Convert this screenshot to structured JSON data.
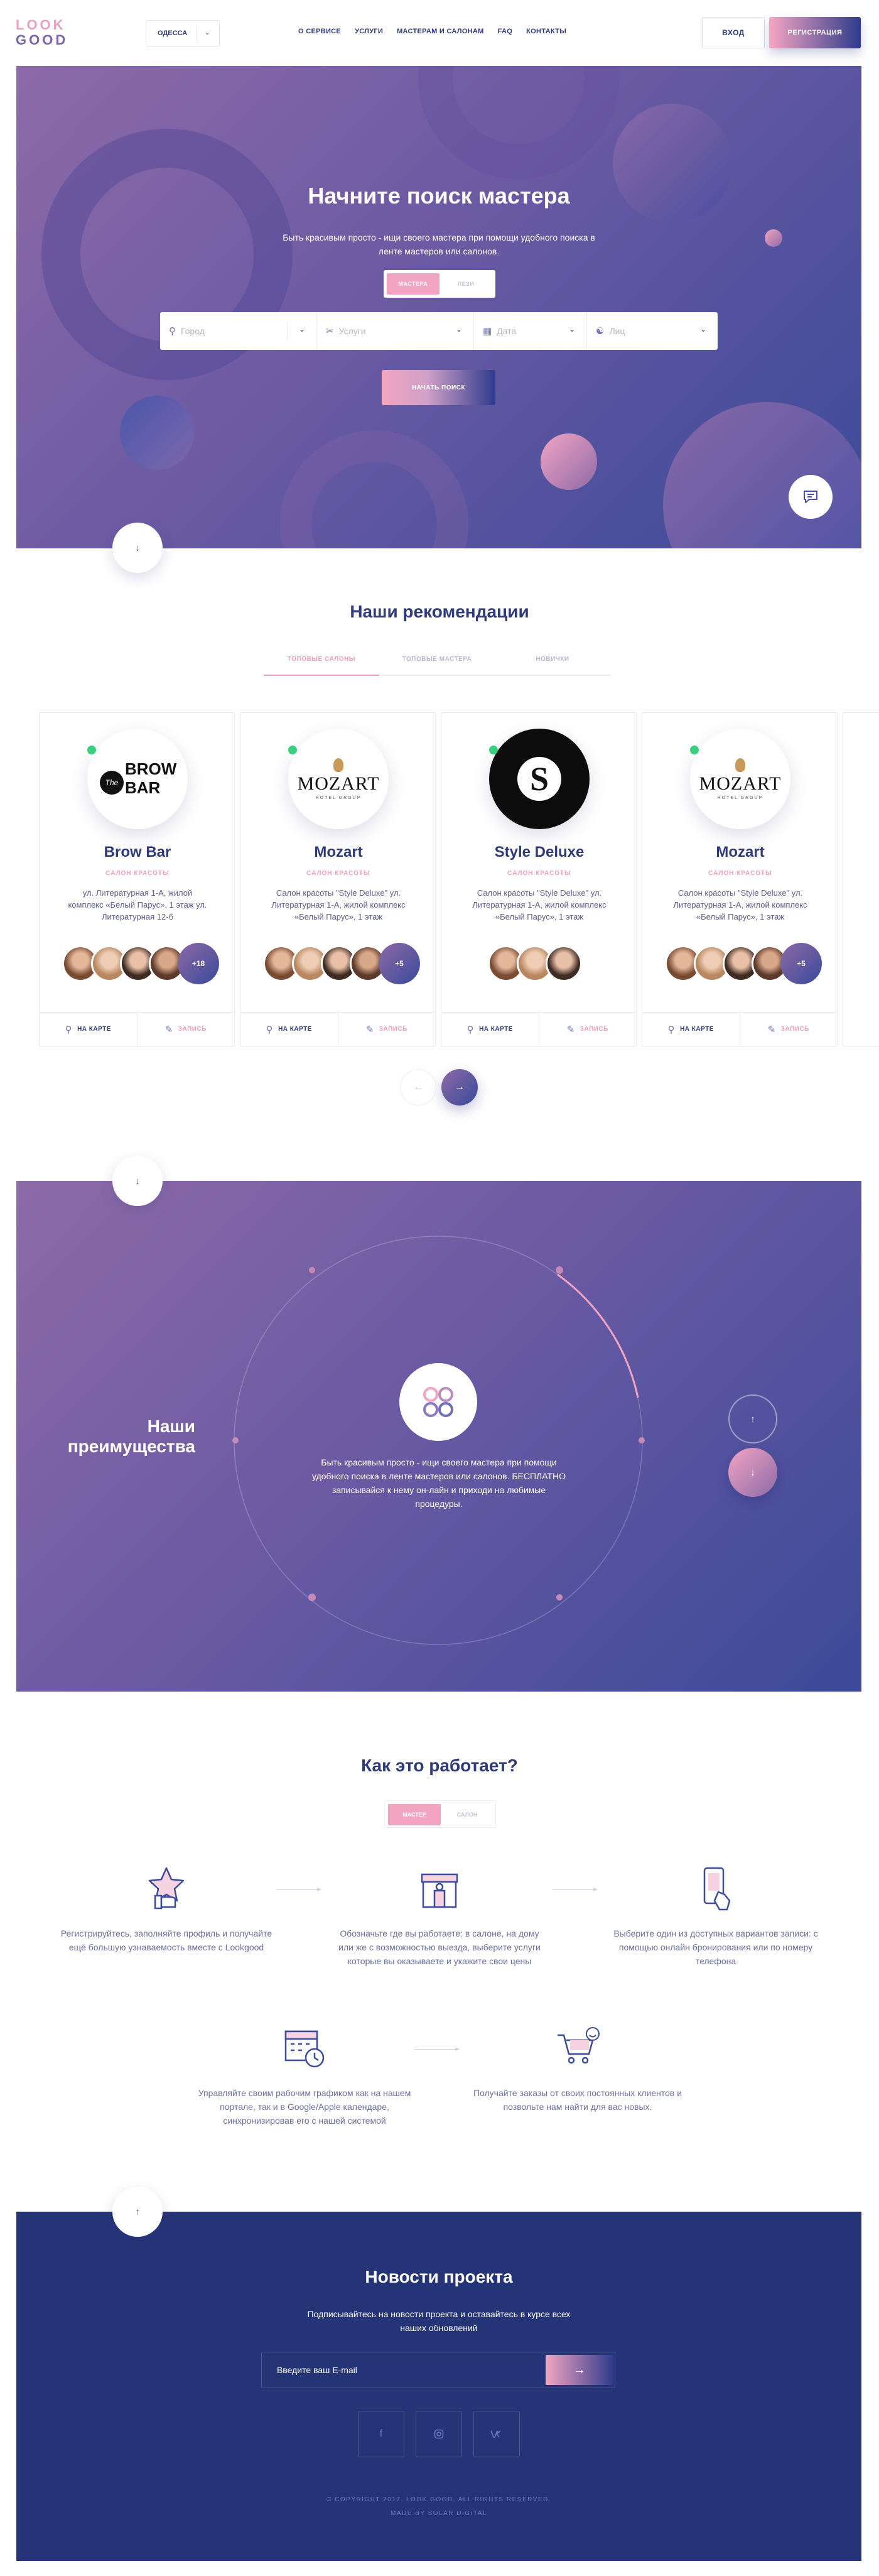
{
  "logo": {
    "line1": "LOOK",
    "line2": "GOOD"
  },
  "header": {
    "city_selected": "ОДЕССА",
    "nav": [
      "О СЕРВИСЕ",
      "УСЛУГИ",
      "МАСТЕРАМ И САЛОНАМ",
      "FAQ",
      "КОНТАКТЫ"
    ],
    "login_label": "ВХОД",
    "register_label": "РЕГИСТРАЦИЯ"
  },
  "hero": {
    "title": "Начните поиск мастера",
    "subtitle": "Быть красивым просто - ищи своего мастера при помощи удобного поиска в ленте мастеров или салонов.",
    "toggle": {
      "active": "МАСТЕРА",
      "inactive": "ЛЕЗИ"
    },
    "search": {
      "city_placeholder": "Город",
      "service_placeholder": "Услуги",
      "date_placeholder": "Дата",
      "persons_placeholder": "Лиц"
    },
    "start_button": "НАЧАТЬ ПОИСК"
  },
  "recommendations": {
    "title": "Наши рекомендации",
    "tabs": [
      "ТОПОВЫЕ САЛОНЫ",
      "ТОПОВЫЕ МАСТЕРА",
      "НОВИЧКИ"
    ],
    "active_tab": "ТОПОВЫЕ САЛОНЫ",
    "cards": [
      {
        "name": "Brow Bar",
        "type": "САЛОН КРАСОТЫ",
        "address": "ул. Литературная 1-А, жилой комплекс «Белый Парус», 1 этаж ул. Литературная 12-б",
        "more": "+18",
        "logo_text": "BROW BAR",
        "logo_small": "The",
        "online": true,
        "map_label": "НА КАРТЕ",
        "book_label": "ЗАПИСЬ"
      },
      {
        "name": "Mozart",
        "type": "САЛОН КРАСОТЫ",
        "address": "Салон красоты \"Style Deluxe\" ул. Литературная 1-А, жилой комплекс «Белый Парус», 1 этаж",
        "more": "+5",
        "logo_text": "MOZART",
        "logo_small": "HOTEL GROUP",
        "online": true,
        "map_label": "НА КАРТЕ",
        "book_label": "ЗАПИСЬ"
      },
      {
        "name": "Style Deluxe",
        "type": "САЛОН КРАСОТЫ",
        "address": "Салон красоты \"Style Deluxe\" ул. Литературная 1-А, жилой комплекс «Белый Парус», 1 этаж",
        "more": "",
        "logo_text": "S",
        "logo_small": "",
        "online": true,
        "map_label": "НА КАРТЕ",
        "book_label": "ЗАПИСЬ"
      },
      {
        "name": "Mozart",
        "type": "САЛОН КРАСОТЫ",
        "address": "Салон красоты \"Style Deluxe\" ул. Литературная 1-А, жилой комплекс «Белый Парус», 1 этаж",
        "more": "+5",
        "logo_text": "MOZART",
        "logo_small": "HOTEL GROUP",
        "online": true,
        "map_label": "НА КАРТЕ",
        "book_label": "ЗАПИСЬ"
      }
    ]
  },
  "advantages": {
    "title": "Наши преимущества",
    "text": "Быть красивым просто - ищи своего мастера при помощи удобного поиска в ленте мастеров или салонов. БЕСПЛАТНО записывайся к нему он-лайн и приходи на любимые процедуры."
  },
  "how": {
    "title": "Как это работает?",
    "toggle": {
      "active": "МАСТЕР",
      "inactive": "САЛОН"
    },
    "steps": [
      {
        "icon": "thumb-star-icon",
        "text": "Регистрируйтесь, заполняйте профиль и получайте ещё большую узнаваемость вместе с Lookgood"
      },
      {
        "icon": "store-person-icon",
        "text": "Обозначьте где вы работаете: в салоне, на дому или же с возможностью выезда, выберите услуги которые вы оказываете и укажите свои цены"
      },
      {
        "icon": "phone-tap-icon",
        "text": "Выберите один из доступных вариантов записи: с помощью онлайн бронирования или по номеру телефона"
      },
      {
        "icon": "calendar-clock-icon",
        "text": "Управляйте своим рабочим графиком как на нашем портале, так и в Google/Apple календаре, синхронизировав его с нашей системой"
      },
      {
        "icon": "cart-smile-icon",
        "text": "Получайте заказы от своих постоянных клиентов и позвольте нам найти для вас новых."
      }
    ]
  },
  "news": {
    "title": "Новости проекта",
    "subtitle": "Подписывайтесь на новости проекта и оставайтесь в курсе всех наших обновлений",
    "email_placeholder": "Введите ваш E-mail",
    "social": [
      "f",
      "instagram",
      "vk"
    ],
    "copyright": "© COPYRIGHT 2017. LOOK GOOD. ALL RIGHTS RESERVED.",
    "made_by": "MADE BY SOLAR DIGITAL"
  },
  "colors": {
    "brand_navy": "#2e3a7c",
    "brand_pink": "#f09cbb",
    "hero_from": "#8d6aa8",
    "hero_to": "#3b4a99",
    "footer_bg": "#253477",
    "online": "#35d17e"
  }
}
